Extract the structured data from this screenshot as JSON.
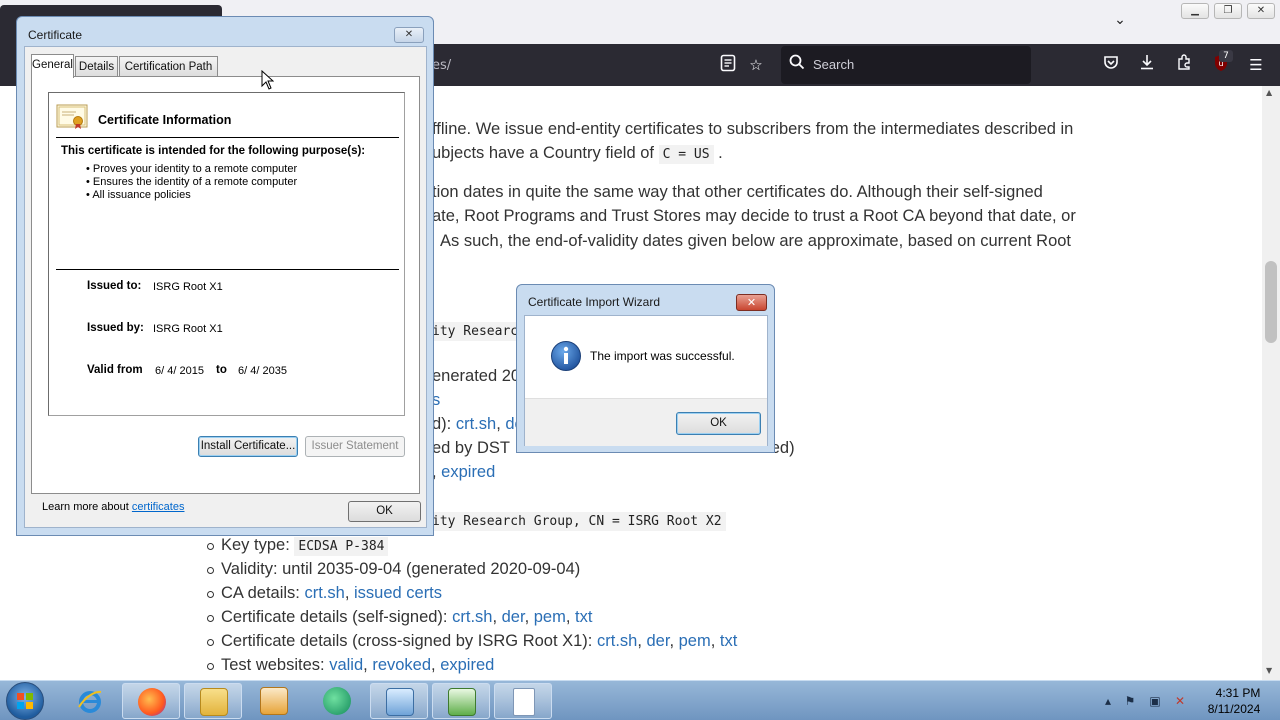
{
  "browser": {
    "url_fragment": "es/",
    "search_placeholder": "Search",
    "extension_badge": "7",
    "tab_list_icon": "chevron-down-icon"
  },
  "page": {
    "lines": [
      "ffline. We issue end-entity certificates to subscribers from the intermediates described in",
      "ubjects have a Country field of",
      "tion dates in quite the same way that other certificates do. Although their self-signed",
      "ate, Root Programs and Trust Stores may decide to trust a Root CA beyond that date, or",
      "As such, the end-of-validity dates given below are approximate, based on current Root"
    ],
    "country_code": "C = US",
    "code_line_1": "ity Researc",
    "generated_partial": "enerated 201",
    "link_s": "s",
    "crt_partial_prefix": "d): ",
    "crt_link": "crt.sh",
    "de_link": "de",
    "crosssigned_partial": "ed by DST",
    "retired_partial": "tired)",
    "expired_partial_link": "expired",
    "code_line_2": "ity Research Group, CN = ISRG Root X2",
    "x2": {
      "keytype_label": "Key type:",
      "keytype_value": "ECDSA P-384",
      "validity": "Validity: until 2035-09-04 (generated 2020-09-04)",
      "ca_label": "CA details:",
      "ca_link1": "crt.sh",
      "ca_link2": "issued certs",
      "self_label": "Certificate details (self-signed):",
      "cross_label": "Certificate details (cross-signed by ISRG Root X1):",
      "links": [
        "crt.sh",
        "der",
        "pem",
        "txt"
      ],
      "test_label": "Test websites:",
      "test_links": [
        "valid",
        "revoked",
        "expired"
      ]
    }
  },
  "cert_dialog": {
    "title": "Certificate",
    "tabs": [
      "General",
      "Details",
      "Certification Path"
    ],
    "info_title": "Certificate Information",
    "purpose_heading": "This certificate is intended for the following purpose(s):",
    "purposes": [
      "Proves your identity to a remote computer",
      "Ensures the identity of a remote computer",
      "All issuance policies"
    ],
    "issued_to_label": "Issued to:",
    "issued_to": "ISRG Root X1",
    "issued_by_label": "Issued by:",
    "issued_by": "ISRG Root X1",
    "valid_from_label": "Valid from",
    "valid_from": "6/ 4/ 2015",
    "to_label": "to",
    "valid_to": "6/ 4/ 2035",
    "install_button": "Install Certificate...",
    "issuer_statement_button": "Issuer Statement",
    "learn_more_text": "Learn more about",
    "learn_more_link": "certificates",
    "ok_button": "OK"
  },
  "import_wizard": {
    "title": "Certificate Import Wizard",
    "message": "The import was successful.",
    "ok_button": "OK"
  },
  "taskbar": {
    "time": "4:31 PM",
    "date": "8/11/2024"
  }
}
